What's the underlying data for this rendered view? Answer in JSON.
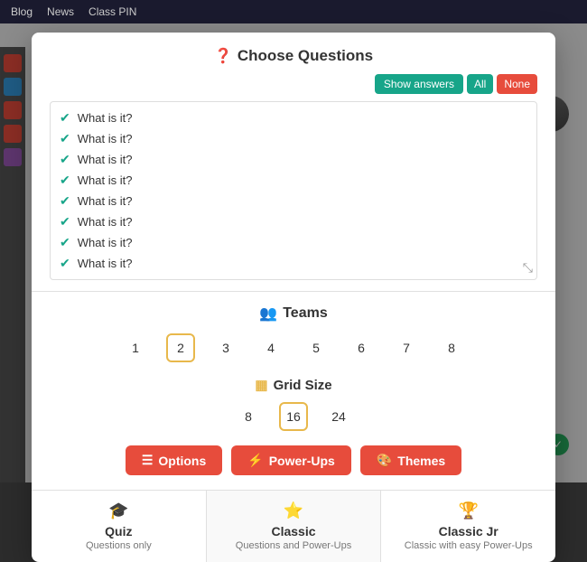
{
  "nav": {
    "items": [
      "Blog",
      "News",
      "Class PIN"
    ]
  },
  "modal": {
    "choose_questions": {
      "title": "Choose Questions",
      "title_icon": "❓",
      "show_answers_label": "Show answers",
      "all_label": "All",
      "none_label": "None",
      "questions": [
        "What is it?",
        "What is it?",
        "What is it?",
        "What is it?",
        "What is it?",
        "What is it?",
        "What is it?",
        "What is it?"
      ]
    },
    "teams": {
      "title": "Teams",
      "title_icon": "👥",
      "numbers": [
        1,
        2,
        3,
        4,
        5,
        6,
        7,
        8
      ],
      "selected": 2
    },
    "grid_size": {
      "title": "Grid Size",
      "title_icon": "▦",
      "options": [
        8,
        16,
        24
      ],
      "selected": 16
    },
    "actions": {
      "options_label": "Options",
      "options_icon": "☰",
      "powerups_label": "Power-Ups",
      "powerups_icon": "⚡",
      "themes_label": "Themes",
      "themes_icon": "🎨"
    },
    "game_modes": [
      {
        "icon": "🎓",
        "title": "Quiz",
        "description": "Questions only"
      },
      {
        "icon": "⭐",
        "title": "Classic",
        "description": "Questions and Power-Ups"
      },
      {
        "icon": "🏆",
        "title": "Classic Jr",
        "description": "Classic with easy Power-Ups"
      }
    ]
  }
}
